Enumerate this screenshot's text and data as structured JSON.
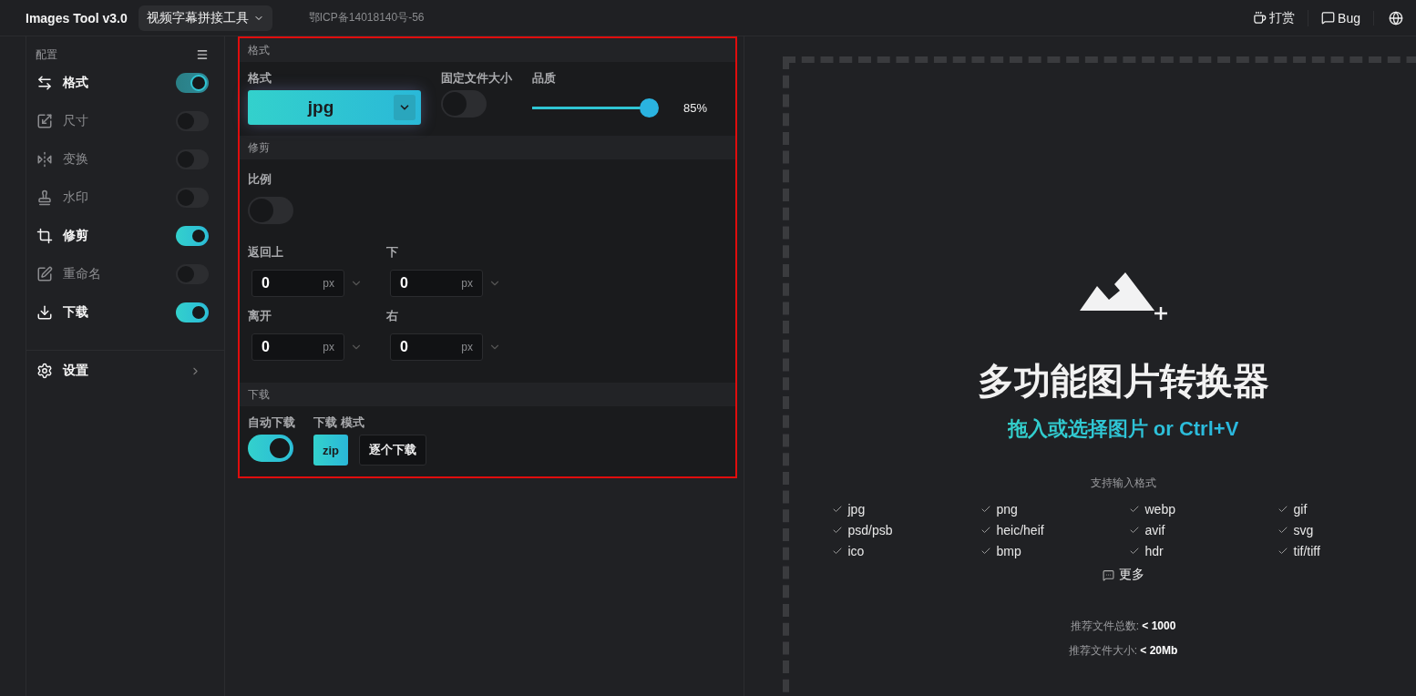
{
  "top_bar": {
    "brand": "Images Tool v3.0",
    "tool_menu": "视频字幕拼接工具",
    "icp": "鄂ICP备14018140号-56",
    "donate": "打赏",
    "bug": "Bug"
  },
  "sidebar": {
    "title": "配置",
    "items": [
      {
        "label": "格式",
        "on": true
      },
      {
        "label": "尺寸",
        "on": false
      },
      {
        "label": "变换",
        "on": false
      },
      {
        "label": "水印",
        "on": false
      },
      {
        "label": "修剪",
        "on": true
      },
      {
        "label": "重命名",
        "on": false
      },
      {
        "label": "下载",
        "on": true
      }
    ],
    "settings": "设置"
  },
  "panel": {
    "highlighted": true,
    "format": {
      "header": "格式",
      "format_label": "格式",
      "format_value": "jpg",
      "fixed_size_label": "固定文件大小",
      "fixed_size_on": false,
      "quality_label": "品质",
      "quality": {
        "level": 0.85,
        "reading": "85%"
      }
    },
    "crop": {
      "header": "修剪",
      "ratio_label": "比例",
      "ratio_on": false,
      "fields": [
        {
          "label": "返回上",
          "value": "0",
          "unit": "px"
        },
        {
          "label": "下",
          "value": "0",
          "unit": "px"
        },
        {
          "label": "离开",
          "value": "0",
          "unit": "px"
        },
        {
          "label": "右",
          "value": "0",
          "unit": "px"
        }
      ]
    },
    "download": {
      "header": "下载",
      "auto_label": "自动下载",
      "auto_on": true,
      "mode_label": "下载 模式",
      "modes": [
        {
          "label": "zip",
          "selected": true
        },
        {
          "label": "逐个下载",
          "selected": false
        }
      ]
    }
  },
  "drop_zone": {
    "title": "多功能图片转换器",
    "subtitle": "拖入或选择图片 or Ctrl+V",
    "formats_heading": "支持输入格式",
    "formats": [
      "jpg",
      "png",
      "webp",
      "gif",
      "psd/psb",
      "heic/heif",
      "avif",
      "svg",
      "ico",
      "bmp",
      "hdr",
      "tif/tiff"
    ],
    "more": "更多",
    "stats": [
      "推荐文件总数: **< 1000**",
      "推荐文件大小: **< 20Mb**"
    ]
  }
}
